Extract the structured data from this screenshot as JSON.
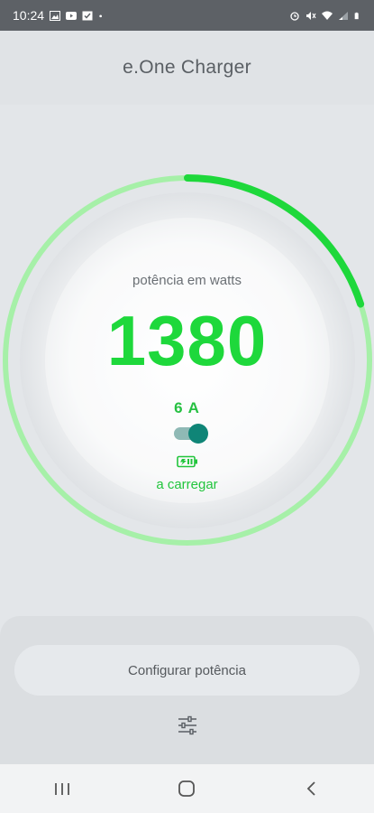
{
  "status_bar": {
    "time": "10:24",
    "left_icons": [
      "image-icon",
      "youtube-icon",
      "check-box-icon",
      "dot-icon"
    ],
    "right_icons": [
      "alarm-icon",
      "mute-icon",
      "wifi-icon",
      "signal-icon",
      "battery-icon"
    ]
  },
  "header": {
    "title": "e.One Charger"
  },
  "gauge": {
    "label": "potência em watts",
    "value": "1380",
    "amps": "6 A",
    "status": "a carregar",
    "progress_fraction": 0.2,
    "toggle_on": true,
    "colors": {
      "accent": "#1ed83b",
      "ring": "#a6f0a8",
      "toggle": "#0f8577"
    }
  },
  "bottom": {
    "config_button_label": "Configurar potência"
  },
  "nav": {
    "items": [
      "recent-apps-icon",
      "home-icon",
      "back-icon"
    ]
  }
}
